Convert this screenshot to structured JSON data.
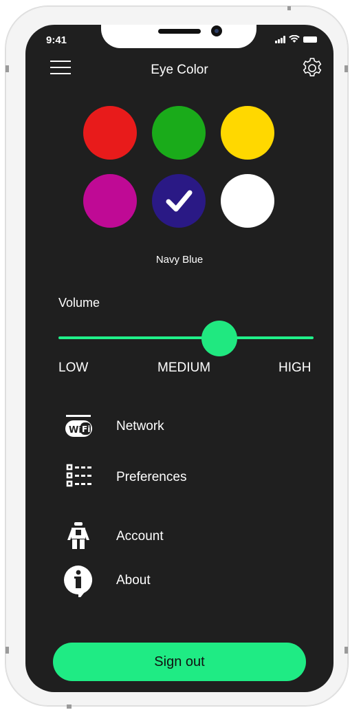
{
  "status_bar": {
    "time": "9:41"
  },
  "header": {
    "title": "Eye Color"
  },
  "colors": {
    "options": [
      {
        "name": "red",
        "hex": "#e81b1b"
      },
      {
        "name": "green",
        "hex": "#1aab1a"
      },
      {
        "name": "yellow",
        "hex": "#ffd800"
      },
      {
        "name": "magenta",
        "hex": "#bf0a95"
      },
      {
        "name": "navy-blue",
        "hex": "#2a1985",
        "selected": true
      },
      {
        "name": "white",
        "hex": "#ffffff"
      }
    ],
    "selected_label": "Navy Blue"
  },
  "volume": {
    "label": "Volume",
    "value_fraction": 0.63,
    "ticks": {
      "low": "LOW",
      "medium": "MEDIUM",
      "high": "HIGH"
    }
  },
  "menu": {
    "items": [
      {
        "label": "Network",
        "icon": "wifi-icon"
      },
      {
        "label": "Preferences",
        "icon": "list-icon"
      },
      {
        "label": "Account",
        "icon": "account-icon"
      },
      {
        "label": "About",
        "icon": "info-icon"
      }
    ]
  },
  "signout": {
    "label": "Sign out"
  },
  "theme": {
    "accent": "#1feb84",
    "background": "#1f1f1f"
  }
}
